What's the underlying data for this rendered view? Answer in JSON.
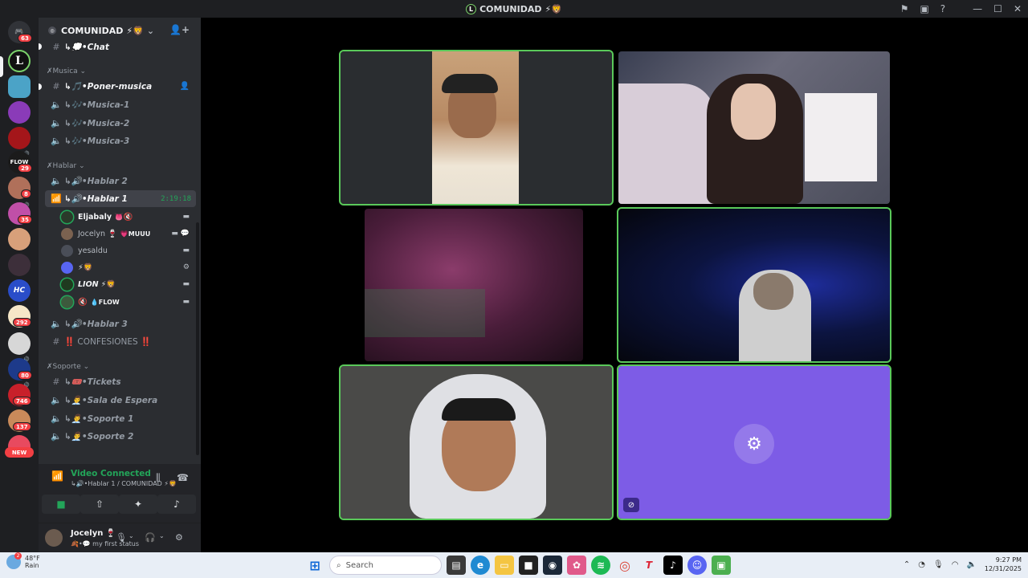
{
  "window": {
    "title": "COMUNIDAD",
    "title_emoji": "⚡🦁",
    "logo_letter": "L"
  },
  "rail": {
    "badges": [
      "63",
      "29",
      "8",
      "35",
      "292",
      "80",
      "746",
      "137"
    ],
    "new_label": "NEW",
    "server_texts": [
      "L",
      "FLOW",
      "HC"
    ]
  },
  "server": {
    "name": "COMUNIDAD",
    "name_emoji": "⚡🦁"
  },
  "channels": {
    "chat": "↳💭•Chat",
    "musica_category": "Musica",
    "poner_musica": "↳🎵•Poner-musica",
    "musica1": "↳🎶•Musica-1",
    "musica2": "↳🎶•Musica-2",
    "musica3": "↳🎶•Musica-3",
    "hablar_category": "Hablar",
    "hablar2": "↳🔊•Hablar 2",
    "hablar1": "↳🔊•Hablar 1",
    "hablar1_timer": "2:19:18",
    "hablar3": "↳🔊•Hablar 3",
    "confesiones": "‼️ CONFESIONES ‼️",
    "soporte_category": "Soporte",
    "tickets": "↳🎟️•Tickets",
    "sala_espera": "↳👨‍💼•Sala de Espera",
    "soporte1": "↳👨‍💼•Soporte 1",
    "soporte2": "↳👨‍💼•Soporte 2"
  },
  "voice_users": [
    {
      "name": "Eljabaly",
      "suffix": "👅🔇",
      "tag": ""
    },
    {
      "name": "Jocelyn",
      "suffix": "🍷",
      "tag": "💗MUUU"
    },
    {
      "name": "yesaldu",
      "suffix": "",
      "tag": ""
    },
    {
      "name": "",
      "suffix": "⚡🦁",
      "tag": ""
    },
    {
      "name": "LION",
      "suffix": "⚡🦁",
      "tag": ""
    },
    {
      "name": "",
      "suffix": "🔇",
      "tag": "💧FLOW"
    }
  ],
  "rtc": {
    "status": "Video Connected",
    "channel": "↳🔊•Hablar 1 / COMUNIDAD ⚡🦁"
  },
  "user": {
    "name": "Jocelyn 🍷",
    "status": "🍂•💬 my first status"
  },
  "taskbar": {
    "weather_temp": "48°F",
    "weather_desc": "Rain",
    "weather_badge": "2",
    "search_placeholder": "Search",
    "time": "9:27 PM",
    "date": "12/31/2025"
  },
  "colors": {
    "speaking_border": "#5ac95a",
    "activity_tile": "#7d5ce6",
    "connected_green": "#23a559",
    "badge_red": "#f23f43"
  }
}
